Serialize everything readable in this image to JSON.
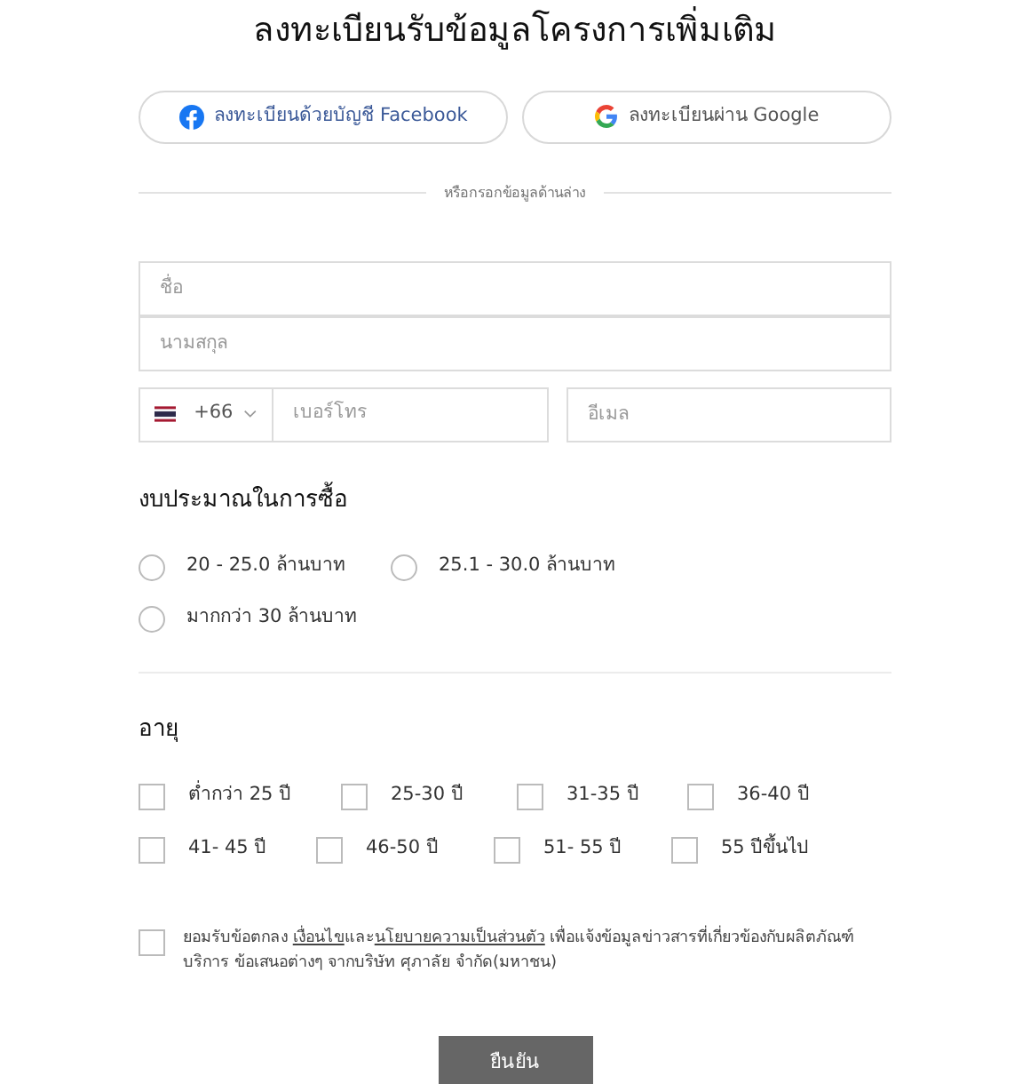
{
  "title": "ลงทะเบียนรับข้อมูลโครงการเพิ่มเติม",
  "social_buttons": [
    {
      "kind": "facebook",
      "label": "ลงทะเบียนด้วยบัญชี Facebook"
    },
    {
      "kind": "google",
      "label": "ลงทะเบียนผ่าน Google"
    }
  ],
  "divider_text": "หรือกรอกข้อมูลด้านล่าง",
  "first_name": {
    "placeholder": "ชื่อ"
  },
  "last_name": {
    "placeholder": "นามสกุล"
  },
  "phone": {
    "country_code": "+66",
    "placeholder": "เบอร์โทร"
  },
  "email": {
    "placeholder": "อีเมล"
  },
  "budget": {
    "heading": "งบประมาณในการซื้อ",
    "options": [
      {
        "label": "20 - 25.0 ล้านบาท",
        "selected": false
      },
      {
        "label": "25.1 - 30.0 ล้านบาท",
        "selected": false
      },
      {
        "label": "มากกว่า 30 ล้านบาท",
        "selected": false
      }
    ]
  },
  "age": {
    "heading": "อายุ",
    "rows": [
      [
        {
          "label": "ต่ำกว่า 25 ปี",
          "checked": false
        },
        {
          "label": "25-30 ปี",
          "checked": false
        },
        {
          "label": "31-35 ปี",
          "checked": false
        },
        {
          "label": "36-40 ปี",
          "checked": false
        }
      ],
      [
        {
          "label": "41- 45 ปี",
          "checked": false
        },
        {
          "label": "46-50 ปี",
          "checked": false
        },
        {
          "label": "51- 55 ปี",
          "checked": false
        },
        {
          "label": "55 ปีขึ้นไป",
          "checked": false
        }
      ]
    ]
  },
  "consent": {
    "checked": false,
    "parts": [
      {
        "kind": "text",
        "text": "ยอมรับข้อตกลง "
      },
      {
        "kind": "link",
        "text": "เงื่อนไข"
      },
      {
        "kind": "text",
        "text": "และ"
      },
      {
        "kind": "link",
        "text": "นโยบายความเป็นส่วนตัว"
      },
      {
        "kind": "text",
        "text": " เพื่อแจ้งข้อมูลข่าวสารที่เกี่ยวข้องกับผลิตภัณฑ์ บริการ ข้อเสนอต่างๆ จากบริษัท ศุภาลัย จำกัด(มหาชน)"
      }
    ]
  },
  "submit": "ยืนยัน"
}
